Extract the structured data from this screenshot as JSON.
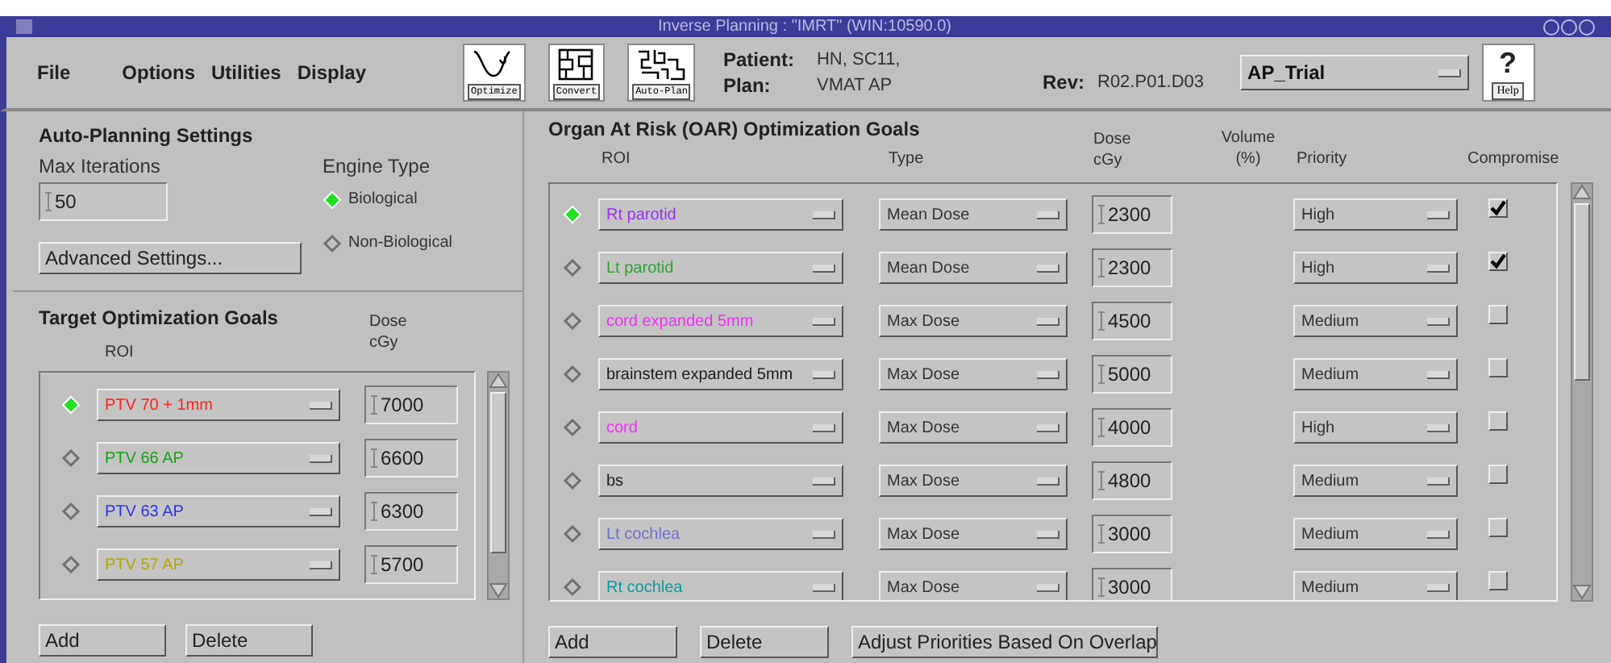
{
  "window": {
    "title": "Inverse Planning : \"IMRT\" (WIN:10590.0)"
  },
  "menu": [
    "File",
    "Options",
    "Utilities",
    "Display"
  ],
  "toolbar": [
    {
      "label": "Optimize",
      "kind": "optimize"
    },
    {
      "label": "Convert",
      "kind": "convert"
    },
    {
      "label": "Auto-Plan",
      "kind": "autoplan"
    }
  ],
  "patient": {
    "label": "Patient:",
    "value": "HN, SC11,"
  },
  "plan": {
    "label": "Plan:",
    "value": "VMAT AP"
  },
  "rev": {
    "label": "Rev:",
    "value": "R02.P01.D03"
  },
  "trial": "AP_Trial",
  "help": {
    "label": "Help",
    "icon": "?"
  },
  "auto_planning": {
    "title": "Auto-Planning Settings",
    "max_iterations_label": "Max Iterations",
    "max_iterations": "50",
    "engine_label": "Engine Type",
    "engines": [
      {
        "label": "Biological",
        "selected": true
      },
      {
        "label": "Non-Biological",
        "selected": false
      }
    ],
    "advanced_button": "Advanced Settings..."
  },
  "target": {
    "title": "Target Optimization Goals",
    "roi_header": "ROI",
    "dose_header": [
      "Dose",
      "cGy"
    ],
    "rows": [
      {
        "selected": true,
        "roi": "PTV 70 + 1mm",
        "color": "#ff2020",
        "dose": "7000"
      },
      {
        "selected": false,
        "roi": "PTV 66 AP",
        "color": "#18a018",
        "dose": "6600"
      },
      {
        "selected": false,
        "roi": "PTV 63 AP",
        "color": "#3030f0",
        "dose": "6300"
      },
      {
        "selected": false,
        "roi": "PTV 57 AP",
        "color": "#b0a800",
        "dose": "5700"
      }
    ],
    "buttons": [
      "Add",
      "Delete"
    ]
  },
  "oar": {
    "title": "Organ At Risk (OAR) Optimization Goals",
    "headers": {
      "roi": "ROI",
      "type": "Type",
      "dose": [
        "Dose",
        "cGy"
      ],
      "volume": [
        "Volume",
        "(%)"
      ],
      "priority": "Priority",
      "compromise": "Compromise"
    },
    "rows": [
      {
        "selected": true,
        "roi": "Rt parotid",
        "color": "#9a30f0",
        "type": "Mean Dose",
        "dose": "2300",
        "priority": "High",
        "checked": true
      },
      {
        "selected": false,
        "roi": "Lt parotid",
        "color": "#30a030",
        "type": "Mean Dose",
        "dose": "2300",
        "priority": "High",
        "checked": true
      },
      {
        "selected": false,
        "roi": "cord expanded 5mm",
        "color": "#f030f0",
        "type": "Max Dose",
        "dose": "4500",
        "priority": "Medium",
        "checked": false
      },
      {
        "selected": false,
        "roi": "brainstem expanded 5mm",
        "color": "#202020",
        "type": "Max Dose",
        "dose": "5000",
        "priority": "Medium",
        "checked": false
      },
      {
        "selected": false,
        "roi": "cord",
        "color": "#f030f0",
        "type": "Max Dose",
        "dose": "4000",
        "priority": "High",
        "checked": false
      },
      {
        "selected": false,
        "roi": "bs",
        "color": "#202020",
        "type": "Max Dose",
        "dose": "4800",
        "priority": "Medium",
        "checked": false
      },
      {
        "selected": false,
        "roi": "Lt cochlea",
        "color": "#7070c8",
        "type": "Max Dose",
        "dose": "3000",
        "priority": "Medium",
        "checked": false
      },
      {
        "selected": false,
        "roi": "Rt cochlea",
        "color": "#0a9a9a",
        "type": "Max Dose",
        "dose": "3000",
        "priority": "Medium",
        "checked": false
      }
    ],
    "buttons": [
      "Add",
      "Delete",
      "Adjust Priorities Based On Overlap"
    ]
  }
}
